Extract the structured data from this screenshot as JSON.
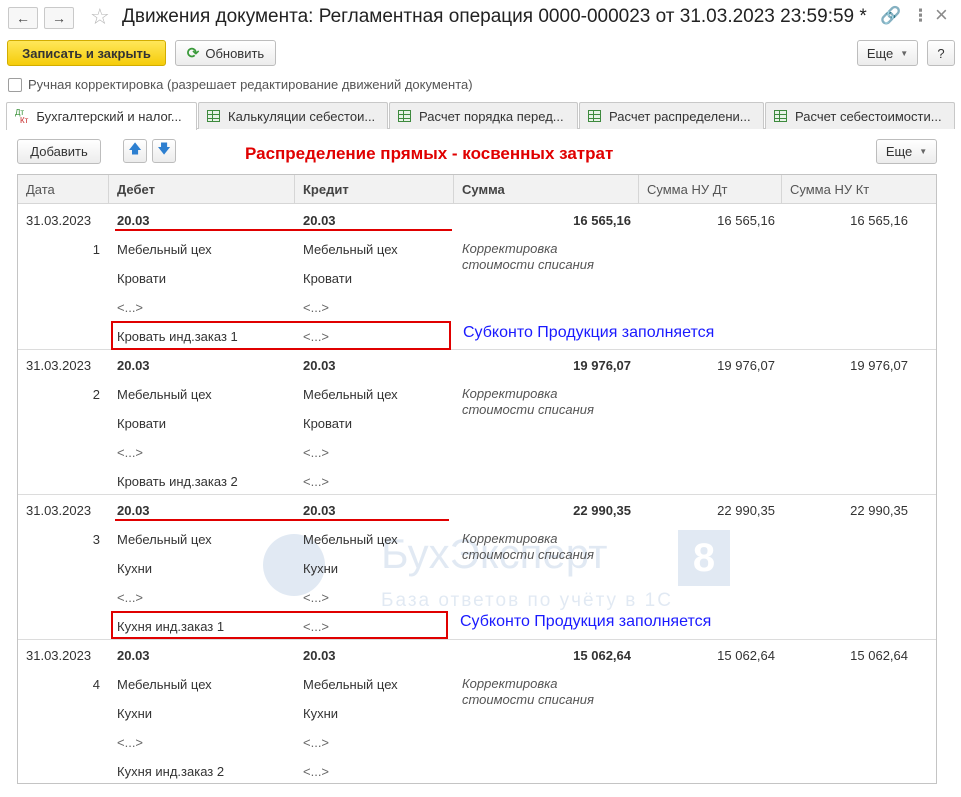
{
  "window": {
    "title": "Движения документа: Регламентная операция 0000-000023 от 31.03.2023 23:59:59 *",
    "back_icon": "←",
    "forward_icon": "→",
    "star_icon": "☆",
    "link_icon": "🔗",
    "menu_icon": "⋮",
    "close_icon": "×"
  },
  "toolbar": {
    "save_close_label": "Записать и закрыть",
    "refresh_label": "Обновить",
    "more_label": "Еще",
    "help_label": "?"
  },
  "manual_correction": {
    "label": "Ручная корректировка (разрешает редактирование движений документа)",
    "checked": false
  },
  "tabs": [
    {
      "label": "Бухгалтерский и налог...",
      "active": true
    },
    {
      "label": "Калькуляции себестои...",
      "active": false
    },
    {
      "label": "Расчет порядка перед...",
      "active": false
    },
    {
      "label": "Расчет распределени...",
      "active": false
    },
    {
      "label": "Расчет себестоимости...",
      "active": false
    }
  ],
  "panel": {
    "add_label": "Добавить",
    "more_label": "Еще",
    "heading": "Распределение прямых - косвенных затрат"
  },
  "table": {
    "columns": [
      "Дата",
      "Дебет",
      "Кредит",
      "Сумма",
      "Сумма НУ Дт",
      "Сумма НУ Кт"
    ],
    "rows": [
      {
        "date": "31.03.2023",
        "num": "1",
        "debit": [
          "20.03",
          "Мебельный цех",
          "Кровати",
          "<...>",
          "Кровать инд.заказ 1"
        ],
        "credit": [
          "20.03",
          "Мебельный цех",
          "Кровати",
          "<...>",
          "<...>"
        ],
        "sum": "16 565,16",
        "note": "Корректировка стоимости списания",
        "nu_dt": "16 565,16",
        "nu_kt": "16 565,16"
      },
      {
        "date": "31.03.2023",
        "num": "2",
        "debit": [
          "20.03",
          "Мебельный цех",
          "Кровати",
          "<...>",
          "Кровать инд.заказ 2"
        ],
        "credit": [
          "20.03",
          "Мебельный цех",
          "Кровати",
          "<...>",
          "<...>"
        ],
        "sum": "19 976,07",
        "note": "Корректировка стоимости списания",
        "nu_dt": "19 976,07",
        "nu_kt": "19 976,07"
      },
      {
        "date": "31.03.2023",
        "num": "3",
        "debit": [
          "20.03",
          "Мебельный цех",
          "Кухни",
          "<...>",
          "Кухня инд.заказ 1"
        ],
        "credit": [
          "20.03",
          "Мебельный цех",
          "Кухни",
          "<...>",
          "<...>"
        ],
        "sum": "22 990,35",
        "note": "Корректировка стоимости списания",
        "nu_dt": "22 990,35",
        "nu_kt": "22 990,35"
      },
      {
        "date": "31.03.2023",
        "num": "4",
        "debit": [
          "20.03",
          "Мебельный цех",
          "Кухни",
          "<...>",
          "Кухня инд.заказ 2"
        ],
        "credit": [
          "20.03",
          "Мебельный цех",
          "Кухни",
          "<...>",
          "<...>"
        ],
        "sum": "15 062,64",
        "note": "Корректировка стоимости списания",
        "nu_dt": "15 062,64",
        "nu_kt": "15 062,64"
      }
    ]
  },
  "annotations": {
    "note_1": "Субконто Продукция заполняется",
    "note_2": "Субконто Продукция заполняется"
  },
  "watermark": {
    "brand": "БухЭксперт",
    "number": "8",
    "subtitle": "База ответов по учёту в 1С"
  }
}
